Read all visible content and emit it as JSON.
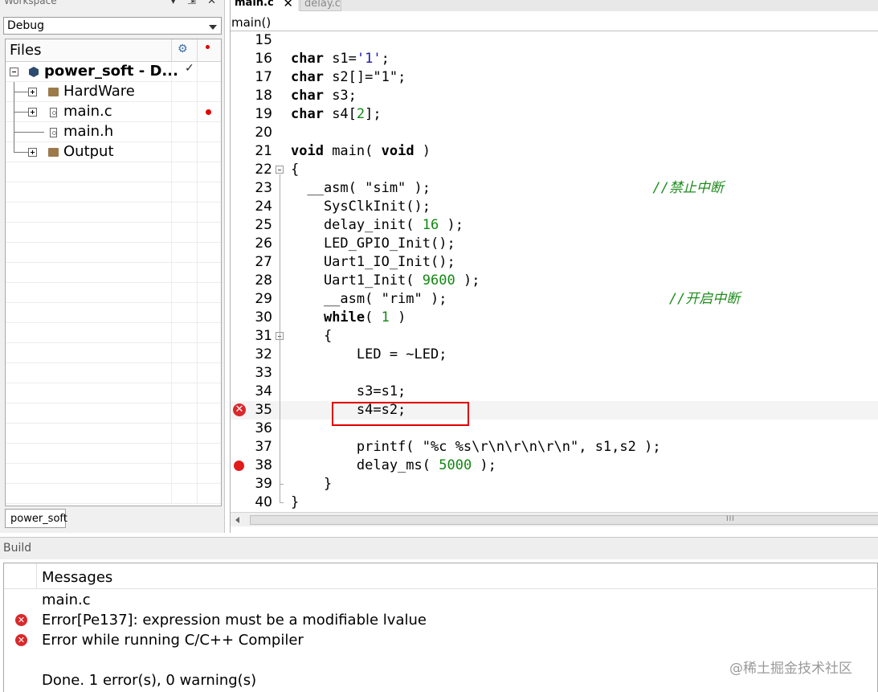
{
  "workspace": {
    "title": "Workspace",
    "controls": "▾ ⇲ ✕",
    "config": "Debug",
    "files_header": "Files",
    "tree": {
      "project": "power_soft - D...",
      "project_check": "✓",
      "items": [
        "HardWare",
        "main.c",
        "main.h",
        "Output"
      ]
    },
    "tab": "power_soft"
  },
  "editor": {
    "tabs": [
      {
        "label": "main.c",
        "close": "✕"
      },
      {
        "label": "delay.c"
      }
    ],
    "function_scope": "main()",
    "lines": [
      {
        "n": "15",
        "html": ""
      },
      {
        "n": "16",
        "html": "<span class=\"kw\">char</span> s1=<span class=\"chr\">'1'</span>;"
      },
      {
        "n": "17",
        "html": "<span class=\"kw\">char</span> s2[]=\"1\";"
      },
      {
        "n": "18",
        "html": "<span class=\"kw\">char</span> s3;"
      },
      {
        "n": "19",
        "html": "<span class=\"kw\">char</span> s4[<span class=\"num\">2</span>];"
      },
      {
        "n": "20",
        "html": ""
      },
      {
        "n": "21",
        "html": "<span class=\"kw\">void</span> main( <span class=\"kw\">void</span> )"
      },
      {
        "n": "22",
        "html": "{"
      },
      {
        "n": "23",
        "html": "  __asm( \"sim\" );                           <span class=\"cmt\">//禁止中断</span>"
      },
      {
        "n": "24",
        "html": "    SysClkInit();"
      },
      {
        "n": "25",
        "html": "    delay_init( <span class=\"num\">16</span> );"
      },
      {
        "n": "26",
        "html": "    LED_GPIO_Init();"
      },
      {
        "n": "27",
        "html": "    Uart1_IO_Init();"
      },
      {
        "n": "28",
        "html": "    Uart1_Init( <span class=\"num\">9600</span> );"
      },
      {
        "n": "29",
        "html": "    __asm( \"rim\" );                           <span class=\"cmt\">//开启中断</span>"
      },
      {
        "n": "30",
        "html": "    <span class=\"kw\">while</span>( <span class=\"num\">1</span> )"
      },
      {
        "n": "31",
        "html": "    {"
      },
      {
        "n": "32",
        "html": "        LED = ~LED;"
      },
      {
        "n": "33",
        "html": ""
      },
      {
        "n": "34",
        "html": "        s3=s1;"
      },
      {
        "n": "35",
        "html": "        s4=s2;"
      },
      {
        "n": "36",
        "html": ""
      },
      {
        "n": "37",
        "html": "        printf( \"%c %s\\r\\n\\r\\n\\r\\n\", s1,s2 );"
      },
      {
        "n": "38",
        "html": "        delay_ms( <span class=\"num\">5000</span> );"
      },
      {
        "n": "39",
        "html": "    }"
      },
      {
        "n": "40",
        "html": "}"
      }
    ],
    "scrollbar_grip": "III"
  },
  "build": {
    "title": "Build",
    "header": "Messages",
    "messages": [
      {
        "text": "main.c",
        "error": false
      },
      {
        "text": "Error[Pe137]: expression must be a modifiable lvalue",
        "error": true
      },
      {
        "text": "Error while running C/C++ Compiler",
        "error": true
      },
      {
        "text": "",
        "error": false
      },
      {
        "text": "Done. 1 error(s), 0 warning(s)",
        "error": false
      }
    ],
    "error_icon": "✕"
  },
  "watermark": "@稀土掘金技术社区"
}
